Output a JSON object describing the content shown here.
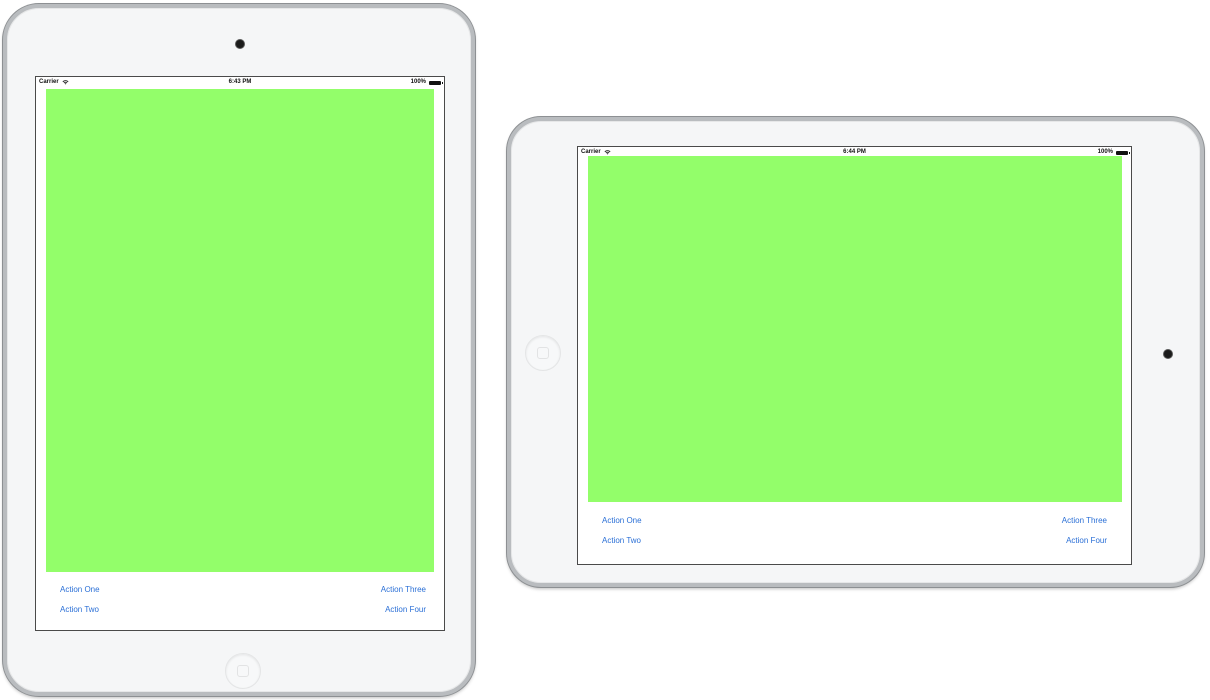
{
  "colors": {
    "content_background": "#93fe6a",
    "action_text": "#2a6fd6",
    "device_body": "#f5f6f7"
  },
  "portrait": {
    "status": {
      "carrier": "Carrier",
      "wifi_icon": "wifi-icon",
      "time": "6:43 PM",
      "battery": "100%",
      "battery_icon": "battery-icon"
    },
    "actions": {
      "one": "Action One",
      "two": "Action Two",
      "three": "Action Three",
      "four": "Action Four"
    }
  },
  "landscape": {
    "status": {
      "carrier": "Carrier",
      "wifi_icon": "wifi-icon",
      "time": "6:44 PM",
      "battery": "100%",
      "battery_icon": "battery-icon"
    },
    "actions": {
      "one": "Action One",
      "two": "Action Two",
      "three": "Action Three",
      "four": "Action Four"
    }
  }
}
